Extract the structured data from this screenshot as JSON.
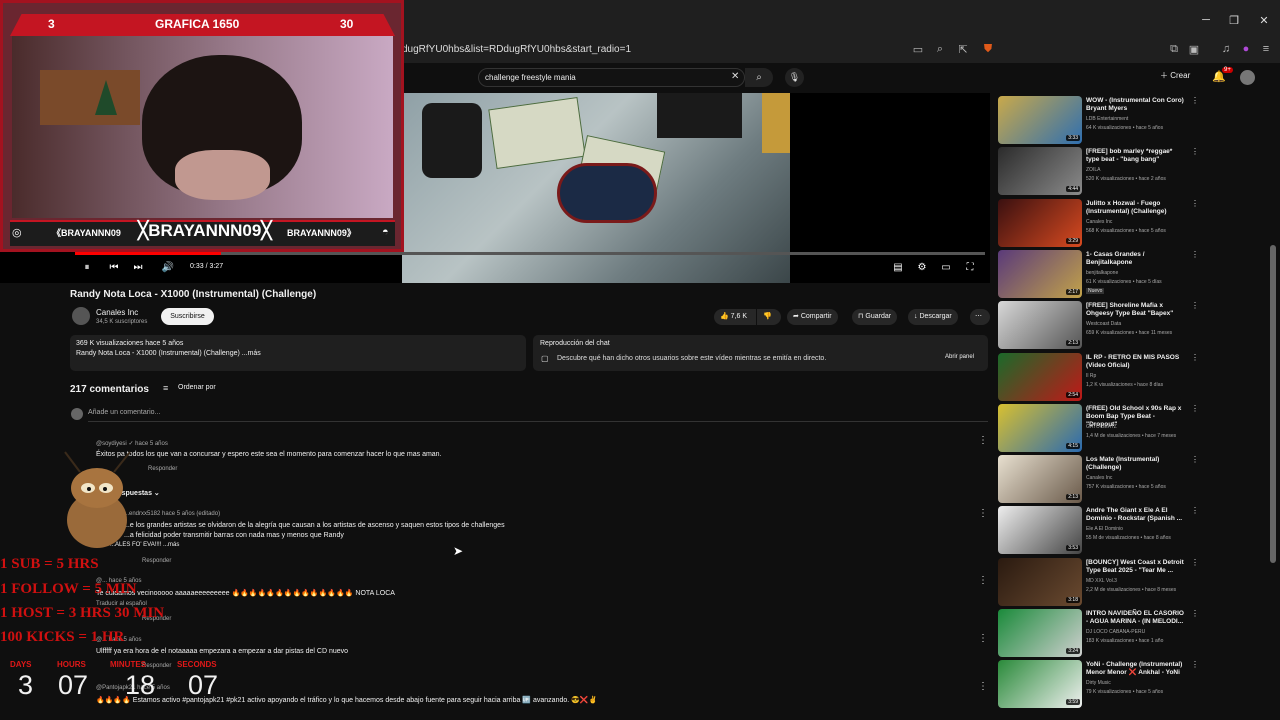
{
  "browser": {
    "url": "dugRfYU0hbs&list=RDdugRfYU0hbs&start_radio=1"
  },
  "search": {
    "query": "challenge freestyle mania"
  },
  "header": {
    "create_label": "Crear",
    "notifications": "9+"
  },
  "stream": {
    "left_count": "3",
    "title": "GRAFICA 1650",
    "right_count": "30",
    "tag_main": "BRAYANNN09",
    "tag_left": "《BRAYANNN09",
    "tag_right": "BRAYANNN09》",
    "goals": [
      "1 SUB = 5 HRS",
      "1 FOLLOW = 5 MIN",
      "1 HOST = 3 HRS 30 MIN",
      "100 KICKS = 1 HR"
    ],
    "timer": {
      "labels": [
        "DAYS",
        "HOURS",
        "MINUTES",
        "SECONDS"
      ],
      "values": [
        "3",
        "07",
        "18",
        "07"
      ]
    }
  },
  "player": {
    "time": "0:33 / 3:27",
    "progress": 0.16
  },
  "video": {
    "title": "Randy Nota Loca - X1000 (Instrumental) (Challenge)",
    "channel": "Canales Inc",
    "subs": "34,5 K suscriptores",
    "subscribe": "Suscribirse",
    "likes": "7,6 K",
    "share": "Compartir",
    "save": "Guardar",
    "download": "Descargar",
    "desc_line1": "369 K visualizaciones  hace 5 años",
    "desc_line2": "Randy Nota Loca - X1000 (Instrumental) (Challenge) ...más",
    "chat_title": "Reproducción del chat",
    "chat_text": "Descubre qué han dicho otros usuarios sobre este vídeo mientras se emitía en directo.",
    "chat_button": "Abrir panel"
  },
  "comments": {
    "count": "217 comentarios",
    "sort": "Ordenar por",
    "add": "Añade un comentario...",
    "items": [
      {
        "author": "@soydiyesi",
        "time": "hace 5 años",
        "text": "Éxitos pa todos los que van a concursar y espero este sea el momento para comenzar hacer lo que mas aman.",
        "reply": "Responder",
        "replies": "respuestas"
      },
      {
        "author": "...endrxx5182",
        "time": "hace 5 años (editado)",
        "text": "...e los grandes artistas se olvidaron de la alegría que causan a los artistas de ascenso y saquen estos tipos de challenges",
        "text2": "...a felicidad poder transmitir barras con nada mas y menos que Randy",
        "text3": "...ALES FO' EVA!!!! ...más",
        "reply": "Responder"
      },
      {
        "author": "@...",
        "time": "hace 5 años",
        "text": "Te cuidamos vecinooooo aaaaaeeeeeeeee 🔥🔥🔥🔥🔥🔥🔥🔥🔥🔥🔥🔥🔥🔥 NOTA LOCA",
        "translate": "Traducir al español",
        "reply": "Responder"
      },
      {
        "author": "@...",
        "time": "hace 5 años",
        "text": "Ulfffff ya era hora de el notaaaaa empezara a empezar a dar pistas del CD nuevo",
        "reply": "Responder"
      },
      {
        "author": "@Pantojapk21",
        "time": "hace 5 años",
        "text": "🔥🔥🔥🔥 Estamos activo #pantojapk21 #pk21 activo apoyando el tráfico y lo que hacemos desde abajo fuente para seguir hacia arriba 🆙 avanzando. 😎❌✌️"
      }
    ]
  },
  "sidebar": [
    {
      "title": "WOW - (Instrumental Con Coro) Bryant Myers",
      "channel": "LDB Entertainment",
      "meta": "64 K visualizaciones • hace 5 años",
      "dur": "3:33",
      "c1": "#c9a94a",
      "c2": "#2f6fb0"
    },
    {
      "title": "[FREE] bob marley *reggae* type beat - \"bang bang\"",
      "channel": "ZOILA",
      "meta": "520 K visualizaciones • hace 2 años",
      "dur": "4:44",
      "c1": "#2b2b2b",
      "c2": "#8b8b8b"
    },
    {
      "title": "Julitto x Hozwal - Fuego (Instrumental) (Challenge)",
      "channel": "Canales Inc",
      "meta": "568 K visualizaciones • hace 5 años",
      "dur": "3:29",
      "c1": "#3a1010",
      "c2": "#d84a20"
    },
    {
      "title": "1- Casas Grandes / Benjitalkapone",
      "channel": "benjitalkapone",
      "meta": "61 K visualizaciones • hace 5 días",
      "badge": "Nuevo",
      "dur": "2:17",
      "c1": "#5a3a7a",
      "c2": "#c2a24a"
    },
    {
      "title": "[FREE] Shoreline Mafia x Ohgeesy Type Beat \"Bapex\"",
      "channel": "Westcoast Data",
      "meta": "659 K visualizaciones • hace 11 meses",
      "dur": "2:13",
      "c1": "#d8d8d8",
      "c2": "#555"
    },
    {
      "title": "IL RP - RETRO EN MIS PASOS (Video Oficial)",
      "channel": "Il Rp",
      "meta": "1,2 K visualizaciones • hace 8 días",
      "dur": "2:54",
      "c1": "#1a6a2a",
      "c2": "#c01818"
    },
    {
      "title": "(FREE) Old School x 90s Rap x Boom Bap Type Beat - \"Dropout\"",
      "channel": "GATO BEATZ",
      "meta": "1,4 M de visualizaciones • hace 7 meses",
      "dur": "4:15",
      "c1": "#d8c030",
      "c2": "#2a6ab0"
    },
    {
      "title": "Los Mate (Instrumental) (Challenge)",
      "channel": "Canales Inc",
      "meta": "757 K visualizaciones • hace 5 años",
      "dur": "2:13",
      "c1": "#e8e0d0",
      "c2": "#6a5a4a"
    },
    {
      "title": "Andre The Giant x Ele A El Dominio - Rockstar (Spanish ...",
      "channel": "Ele A El Dominio",
      "meta": "55 M de visualizaciones • hace 8 años",
      "dur": "3:53",
      "c1": "#eeeeee",
      "c2": "#444"
    },
    {
      "title": "[BOUNCY] West Coast x Detroit Type Beat 2025 - \"Tear Me ...",
      "channel": "MD XXL Vol.3",
      "meta": "2,2 M de visualizaciones • hace 8 meses",
      "dur": "3:18",
      "c1": "#2a1a10",
      "c2": "#6a4a30"
    },
    {
      "title": "INTRO NAVIDEÑO EL CASORIO - AGUA MARINA - (IN MELODI...",
      "channel": "DJ LOCO CABANA-PERU",
      "meta": "183 K visualizaciones • hace 1 año",
      "dur": "3:24",
      "c1": "#1a8a3a",
      "c2": "#d0d0d0"
    },
    {
      "title": "YoNi - Challenge (Instrumental) Menor Menor ❌ Ankhal - YoNi",
      "channel": "Dirty Music",
      "meta": "79 K visualizaciones • hace 5 años",
      "dur": "3:59",
      "c1": "#2a8a3a",
      "c2": "#f0f0f0"
    }
  ]
}
